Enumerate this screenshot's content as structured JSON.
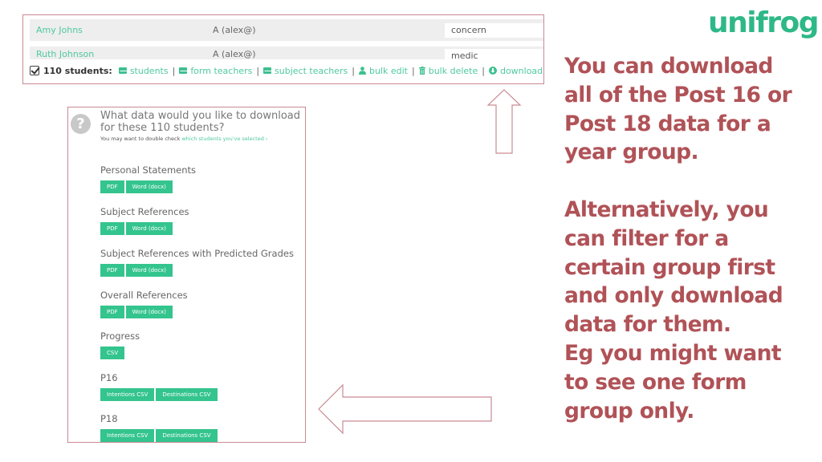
{
  "logo": {
    "text": "unifrog",
    "color": "#2eb888"
  },
  "student_list": {
    "rows": [
      {
        "name": "Amy Johns",
        "teacher": "A (alex@)",
        "note": "concern"
      },
      {
        "name": "Ruth Johnson",
        "teacher": "A (alex@)",
        "note": "medic"
      }
    ]
  },
  "action_bar": {
    "checkbox_icon": "check-square-icon",
    "count_label": "110 students:",
    "links": [
      {
        "icon": "envelope-icon",
        "label": "students"
      },
      {
        "icon": "envelope-icon",
        "label": "form teachers"
      },
      {
        "icon": "envelope-icon",
        "label": "subject teachers"
      },
      {
        "icon": "user-icon",
        "label": "bulk edit"
      },
      {
        "icon": "trash-icon",
        "label": "bulk delete"
      },
      {
        "icon": "download-icon",
        "label": "download"
      }
    ],
    "separator": "|"
  },
  "download_dialog": {
    "icon": "question-circle-icon",
    "title": "What data would you like to download for these 110 students?",
    "subtitle_prefix": "You may want to double check ",
    "subtitle_link": "which students you've selected ›",
    "sections": [
      {
        "label": "Personal Statements",
        "buttons": [
          "PDF",
          "Word (docx)"
        ]
      },
      {
        "label": "Subject References",
        "buttons": [
          "PDF",
          "Word (docx)"
        ]
      },
      {
        "label": "Subject References with Predicted Grades",
        "buttons": [
          "PDF",
          "Word (docx)"
        ]
      },
      {
        "label": "Overall References",
        "buttons": [
          "PDF",
          "Word (docx)"
        ]
      },
      {
        "label": "Progress",
        "buttons": [
          "CSV"
        ]
      },
      {
        "label": "P16",
        "buttons": [
          "Intentions CSV",
          "Destinations CSV"
        ]
      },
      {
        "label": "P18",
        "buttons": [
          "Intentions CSV",
          "Destinations CSV"
        ]
      }
    ]
  },
  "annotations": {
    "paragraph_1": [
      "You can download",
      "all of the Post 16 or",
      "Post 18 data for a",
      "year group."
    ],
    "paragraph_2": [
      "Alternatively, you",
      "can filter for a",
      "certain group first",
      "and only download",
      "data for them.",
      "Eg you might want",
      "to see one form",
      "group only."
    ],
    "text_color": "#b05257",
    "arrow_color": "#c98a94"
  }
}
